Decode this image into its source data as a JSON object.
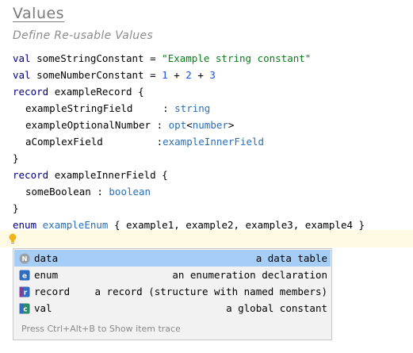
{
  "header": {
    "title": "Values",
    "subtitle": "Define Re-usable Values"
  },
  "code": {
    "l1": {
      "kw": "val",
      "name": "someStringConstant",
      "eq": "=",
      "value": "\"Example string constant\""
    },
    "l2": {
      "kw": "val",
      "name": "someNumberConstant",
      "eq": "=",
      "n1": "1",
      "p1": "+",
      "n2": "2",
      "p2": "+",
      "n3": "3"
    },
    "l3": {
      "kw": "record",
      "name": "exampleRecord",
      "brace": "{"
    },
    "l4": {
      "field": "exampleStringField    ",
      "colon": ":",
      "type": "string"
    },
    "l5": {
      "field": "exampleOptionalNumber",
      "colon": ":",
      "type_opt": "opt",
      "lt": "<",
      "type_inner": "number",
      "gt": ">"
    },
    "l6": {
      "field": "aComplexField        ",
      "colon": ":",
      "type": "exampleInnerField"
    },
    "l7": {
      "brace": "}"
    },
    "l8": {
      "kw": "record",
      "name": "exampleInnerField",
      "brace": "{"
    },
    "l9": {
      "field": "someBoolean",
      "colon": ":",
      "type": "boolean"
    },
    "l10": {
      "brace": "}"
    },
    "l11": {
      "kw": "enum",
      "name": "exampleEnum",
      "open": "{",
      "members": "example1, example2, example3, example4",
      "close": "}"
    }
  },
  "completion": {
    "items": [
      {
        "icon": "N",
        "name": "data",
        "description": "a data table"
      },
      {
        "icon": "e",
        "name": "enum",
        "description": "an enumeration declaration"
      },
      {
        "icon": "r",
        "name": "record",
        "description": "a record (structure with named members)"
      },
      {
        "icon": "c",
        "name": "val",
        "description": "a global constant"
      }
    ],
    "footer": "Press Ctrl+Alt+B to Show item trace"
  },
  "colors": {
    "keyword": "#000080",
    "type": "#2a6fb8",
    "string": "#067d17",
    "number": "#1750eb",
    "selection": "#a6cdf5",
    "caret_line": "#fffae3"
  }
}
